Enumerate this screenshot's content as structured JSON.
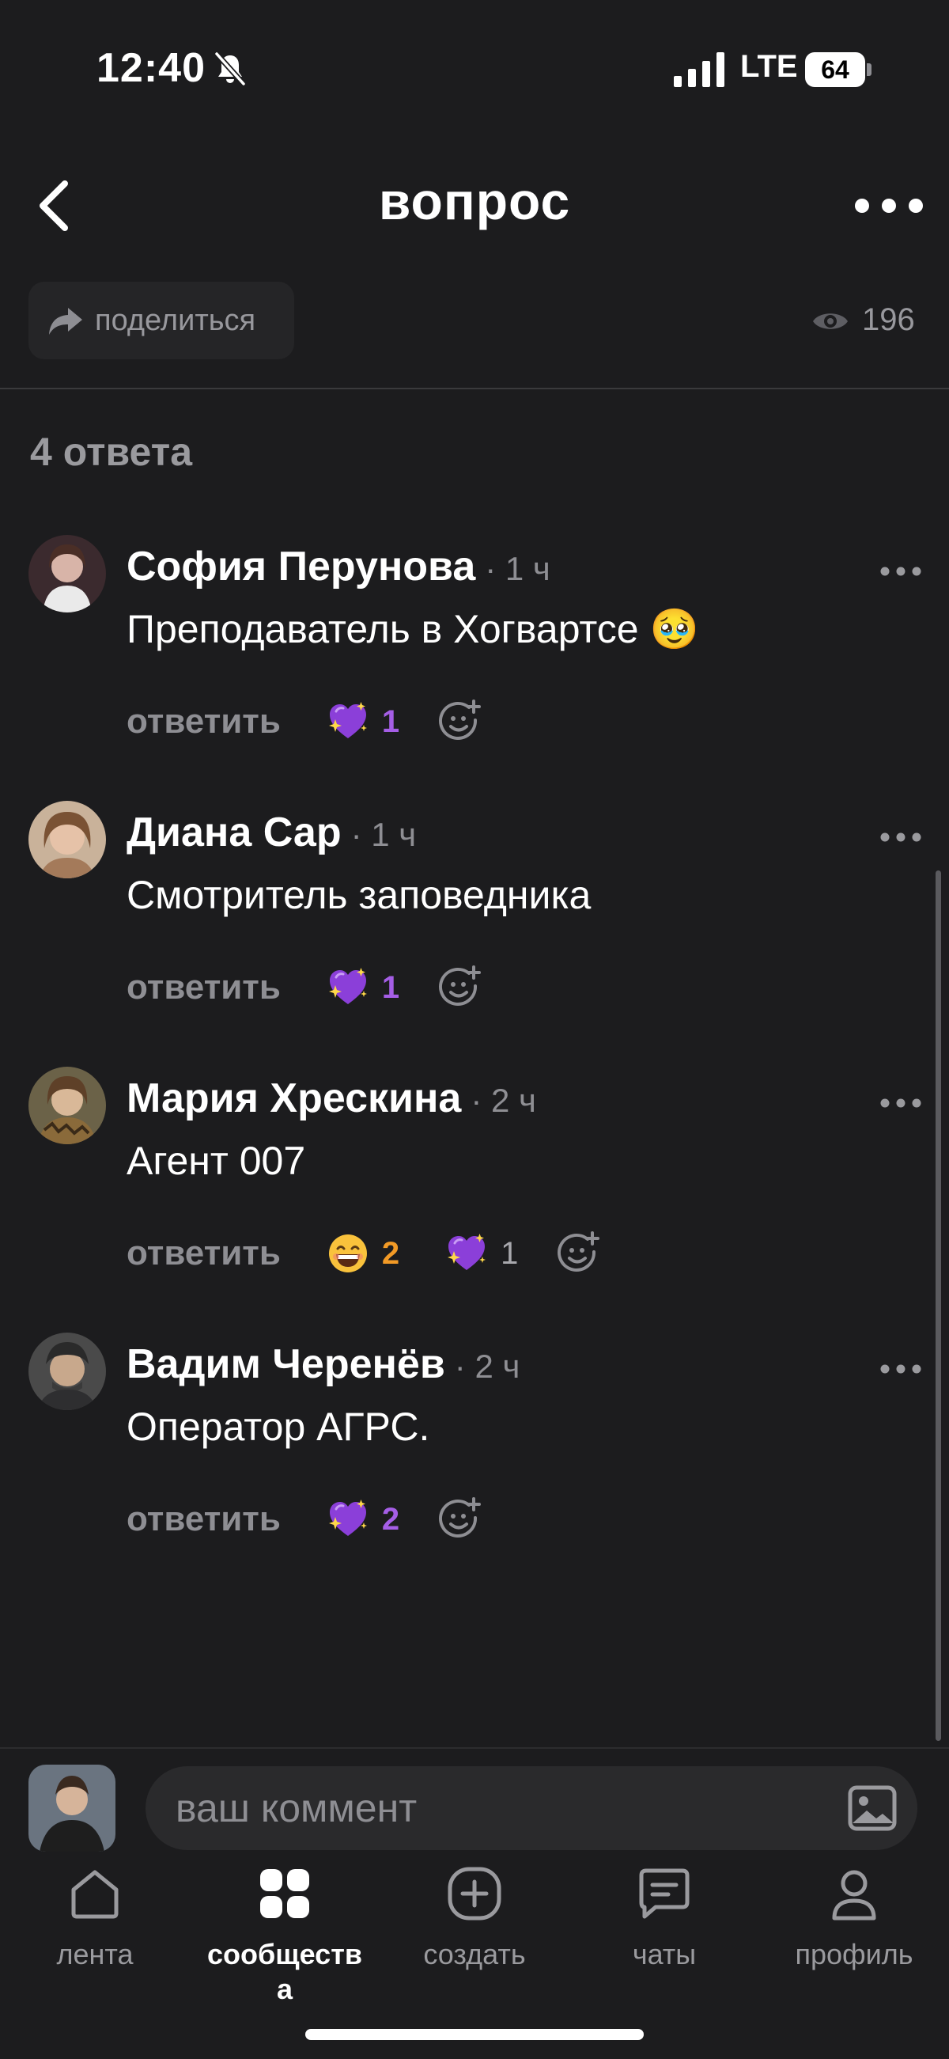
{
  "status_bar": {
    "time": "12:40",
    "network": "LTE",
    "battery": "64"
  },
  "header": {
    "title": "вопрос"
  },
  "share": {
    "label": "поделиться"
  },
  "stats": {
    "views": "196"
  },
  "answers_label": "4 ответа",
  "reply_label": "ответить",
  "comments": [
    {
      "author": "София Перунова",
      "time": "· 1 ч",
      "text": "Преподаватель в Хогвартсе 🥹",
      "reactions": [
        {
          "icon": "purple-heart-sparkle-icon",
          "count": "1",
          "color": "#a55ee6"
        }
      ]
    },
    {
      "author": "Диана Сар",
      "time": "· 1 ч",
      "text": "Смотритель заповедника",
      "reactions": [
        {
          "icon": "purple-heart-sparkle-icon",
          "count": "1",
          "color": "#a55ee6"
        }
      ]
    },
    {
      "author": "Мария Хрескина",
      "time": "· 2 ч",
      "text": "Агент 007",
      "reactions": [
        {
          "icon": "grinning-face-icon",
          "count": "2",
          "color": "#f29a26"
        },
        {
          "icon": "purple-heart-sparkle-icon",
          "count": "1",
          "color": "#a8a8ad"
        }
      ]
    },
    {
      "author": "Вадим Черенёв",
      "time": "· 2 ч",
      "text": "Оператор АГРС.",
      "reactions": [
        {
          "icon": "purple-heart-sparkle-icon",
          "count": "2",
          "color": "#a55ee6"
        }
      ]
    }
  ],
  "composer": {
    "placeholder": "ваш коммент"
  },
  "tabs": [
    {
      "label": "лента",
      "icon": "home-icon"
    },
    {
      "label": "сообществ\nа",
      "icon": "communities-grid-icon"
    },
    {
      "label": "создать",
      "icon": "plus-square-icon"
    },
    {
      "label": "чаты",
      "icon": "chat-bubble-icon"
    },
    {
      "label": "профиль",
      "icon": "person-icon"
    }
  ],
  "colors": {
    "background": "#1c1c1e",
    "accent_purple": "#a55ee6",
    "accent_orange": "#f29a26",
    "muted": "#8e8e93"
  }
}
